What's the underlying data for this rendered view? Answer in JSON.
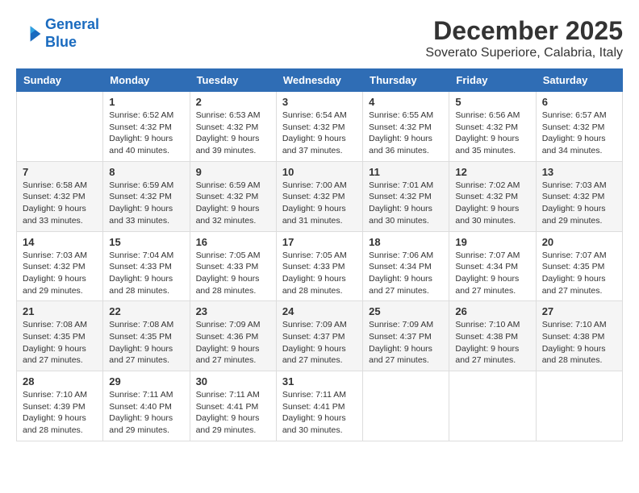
{
  "header": {
    "logo_line1": "General",
    "logo_line2": "Blue",
    "month": "December 2025",
    "location": "Soverato Superiore, Calabria, Italy"
  },
  "days_of_week": [
    "Sunday",
    "Monday",
    "Tuesday",
    "Wednesday",
    "Thursday",
    "Friday",
    "Saturday"
  ],
  "weeks": [
    [
      {
        "day": "",
        "info": ""
      },
      {
        "day": "1",
        "info": "Sunrise: 6:52 AM\nSunset: 4:32 PM\nDaylight: 9 hours\nand 40 minutes."
      },
      {
        "day": "2",
        "info": "Sunrise: 6:53 AM\nSunset: 4:32 PM\nDaylight: 9 hours\nand 39 minutes."
      },
      {
        "day": "3",
        "info": "Sunrise: 6:54 AM\nSunset: 4:32 PM\nDaylight: 9 hours\nand 37 minutes."
      },
      {
        "day": "4",
        "info": "Sunrise: 6:55 AM\nSunset: 4:32 PM\nDaylight: 9 hours\nand 36 minutes."
      },
      {
        "day": "5",
        "info": "Sunrise: 6:56 AM\nSunset: 4:32 PM\nDaylight: 9 hours\nand 35 minutes."
      },
      {
        "day": "6",
        "info": "Sunrise: 6:57 AM\nSunset: 4:32 PM\nDaylight: 9 hours\nand 34 minutes."
      }
    ],
    [
      {
        "day": "7",
        "info": "Sunrise: 6:58 AM\nSunset: 4:32 PM\nDaylight: 9 hours\nand 33 minutes."
      },
      {
        "day": "8",
        "info": "Sunrise: 6:59 AM\nSunset: 4:32 PM\nDaylight: 9 hours\nand 33 minutes."
      },
      {
        "day": "9",
        "info": "Sunrise: 6:59 AM\nSunset: 4:32 PM\nDaylight: 9 hours\nand 32 minutes."
      },
      {
        "day": "10",
        "info": "Sunrise: 7:00 AM\nSunset: 4:32 PM\nDaylight: 9 hours\nand 31 minutes."
      },
      {
        "day": "11",
        "info": "Sunrise: 7:01 AM\nSunset: 4:32 PM\nDaylight: 9 hours\nand 30 minutes."
      },
      {
        "day": "12",
        "info": "Sunrise: 7:02 AM\nSunset: 4:32 PM\nDaylight: 9 hours\nand 30 minutes."
      },
      {
        "day": "13",
        "info": "Sunrise: 7:03 AM\nSunset: 4:32 PM\nDaylight: 9 hours\nand 29 minutes."
      }
    ],
    [
      {
        "day": "14",
        "info": "Sunrise: 7:03 AM\nSunset: 4:32 PM\nDaylight: 9 hours\nand 29 minutes."
      },
      {
        "day": "15",
        "info": "Sunrise: 7:04 AM\nSunset: 4:33 PM\nDaylight: 9 hours\nand 28 minutes."
      },
      {
        "day": "16",
        "info": "Sunrise: 7:05 AM\nSunset: 4:33 PM\nDaylight: 9 hours\nand 28 minutes."
      },
      {
        "day": "17",
        "info": "Sunrise: 7:05 AM\nSunset: 4:33 PM\nDaylight: 9 hours\nand 28 minutes."
      },
      {
        "day": "18",
        "info": "Sunrise: 7:06 AM\nSunset: 4:34 PM\nDaylight: 9 hours\nand 27 minutes."
      },
      {
        "day": "19",
        "info": "Sunrise: 7:07 AM\nSunset: 4:34 PM\nDaylight: 9 hours\nand 27 minutes."
      },
      {
        "day": "20",
        "info": "Sunrise: 7:07 AM\nSunset: 4:35 PM\nDaylight: 9 hours\nand 27 minutes."
      }
    ],
    [
      {
        "day": "21",
        "info": "Sunrise: 7:08 AM\nSunset: 4:35 PM\nDaylight: 9 hours\nand 27 minutes."
      },
      {
        "day": "22",
        "info": "Sunrise: 7:08 AM\nSunset: 4:35 PM\nDaylight: 9 hours\nand 27 minutes."
      },
      {
        "day": "23",
        "info": "Sunrise: 7:09 AM\nSunset: 4:36 PM\nDaylight: 9 hours\nand 27 minutes."
      },
      {
        "day": "24",
        "info": "Sunrise: 7:09 AM\nSunset: 4:37 PM\nDaylight: 9 hours\nand 27 minutes."
      },
      {
        "day": "25",
        "info": "Sunrise: 7:09 AM\nSunset: 4:37 PM\nDaylight: 9 hours\nand 27 minutes."
      },
      {
        "day": "26",
        "info": "Sunrise: 7:10 AM\nSunset: 4:38 PM\nDaylight: 9 hours\nand 27 minutes."
      },
      {
        "day": "27",
        "info": "Sunrise: 7:10 AM\nSunset: 4:38 PM\nDaylight: 9 hours\nand 28 minutes."
      }
    ],
    [
      {
        "day": "28",
        "info": "Sunrise: 7:10 AM\nSunset: 4:39 PM\nDaylight: 9 hours\nand 28 minutes."
      },
      {
        "day": "29",
        "info": "Sunrise: 7:11 AM\nSunset: 4:40 PM\nDaylight: 9 hours\nand 29 minutes."
      },
      {
        "day": "30",
        "info": "Sunrise: 7:11 AM\nSunset: 4:41 PM\nDaylight: 9 hours\nand 29 minutes."
      },
      {
        "day": "31",
        "info": "Sunrise: 7:11 AM\nSunset: 4:41 PM\nDaylight: 9 hours\nand 30 minutes."
      },
      {
        "day": "",
        "info": ""
      },
      {
        "day": "",
        "info": ""
      },
      {
        "day": "",
        "info": ""
      }
    ]
  ]
}
